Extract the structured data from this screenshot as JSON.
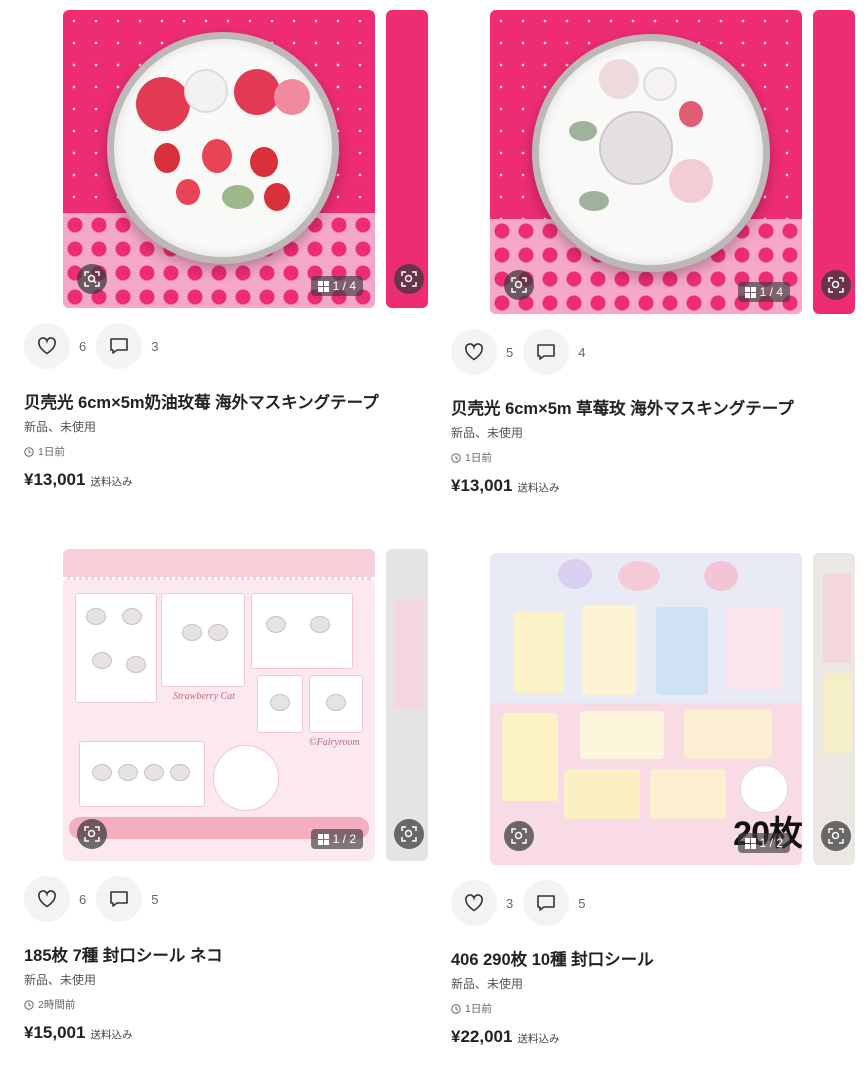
{
  "colors": {
    "accent_pink": "#ee2c74",
    "text": "#222222",
    "muted": "#666666"
  },
  "icons": {
    "like": "heart-icon",
    "comment": "comment-icon",
    "zoom": "zoom-scan-icon",
    "gallery": "grid-icon",
    "time": "clock-icon"
  },
  "listings": [
    {
      "image_counter": "1 / 4",
      "likes": "6",
      "comments": "3",
      "title": "贝壳光 6cm×5m奶油玫莓 海外マスキングテープ",
      "condition": "新品、未使用",
      "posted": "1日前",
      "price": "¥13,001",
      "shipping": "送料込み"
    },
    {
      "image_counter": "1 / 4",
      "likes": "5",
      "comments": "4",
      "title": "贝壳光 6cm×5m 草莓玫 海外マスキングテープ",
      "condition": "新品、未使用",
      "posted": "1日前",
      "price": "¥13,001",
      "shipping": "送料込み"
    },
    {
      "image_counter": "1 / 2",
      "image_caption_strawberry": "Strawberry Cat",
      "image_caption_brand": "©Fairyroom",
      "likes": "6",
      "comments": "5",
      "title": "185枚 7種 封口シール ネコ",
      "condition": "新品、未使用",
      "posted": "2時間前",
      "price": "¥15,001",
      "shipping": "送料込み"
    },
    {
      "image_counter": "1 / 2",
      "image_overlay": "20枚",
      "likes": "3",
      "comments": "5",
      "title": "406 290枚 10種 封口シール",
      "condition": "新品、未使用",
      "posted": "1日前",
      "price": "¥22,001",
      "shipping": "送料込み"
    }
  ]
}
